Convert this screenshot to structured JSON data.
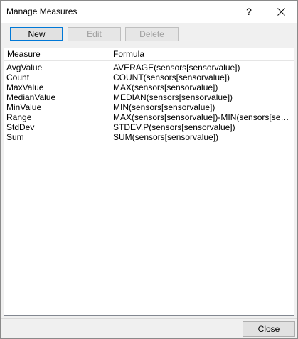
{
  "window": {
    "title": "Manage Measures",
    "help_glyph": "?"
  },
  "toolbar": {
    "new_label": "New",
    "edit_label": "Edit",
    "delete_label": "Delete"
  },
  "table": {
    "columns": [
      "Measure",
      "Formula"
    ],
    "rows": [
      {
        "measure": "AvgValue",
        "formula": "AVERAGE(sensors[sensorvalue])"
      },
      {
        "measure": "Count",
        "formula": "COUNT(sensors[sensorvalue])"
      },
      {
        "measure": "MaxValue",
        "formula": "MAX(sensors[sensorvalue])"
      },
      {
        "measure": "MedianValue",
        "formula": "MEDIAN(sensors[sensorvalue])"
      },
      {
        "measure": "MinValue",
        "formula": "MIN(sensors[sensorvalue])"
      },
      {
        "measure": "Range",
        "formula": "MAX(sensors[sensorvalue])-MIN(sensors[sensorvalue])"
      },
      {
        "measure": "StdDev",
        "formula": "STDEV.P(sensors[sensorvalue])"
      },
      {
        "measure": "Sum",
        "formula": "SUM(sensors[sensorvalue])"
      }
    ]
  },
  "footer": {
    "close_label": "Close"
  },
  "icons": {
    "help": "question-mark-icon",
    "close": "close-icon"
  },
  "colors": {
    "default_button_border": "#0078d7",
    "disabled_text": "#a0a0a0",
    "dialog_background": "#f0f0f0"
  }
}
